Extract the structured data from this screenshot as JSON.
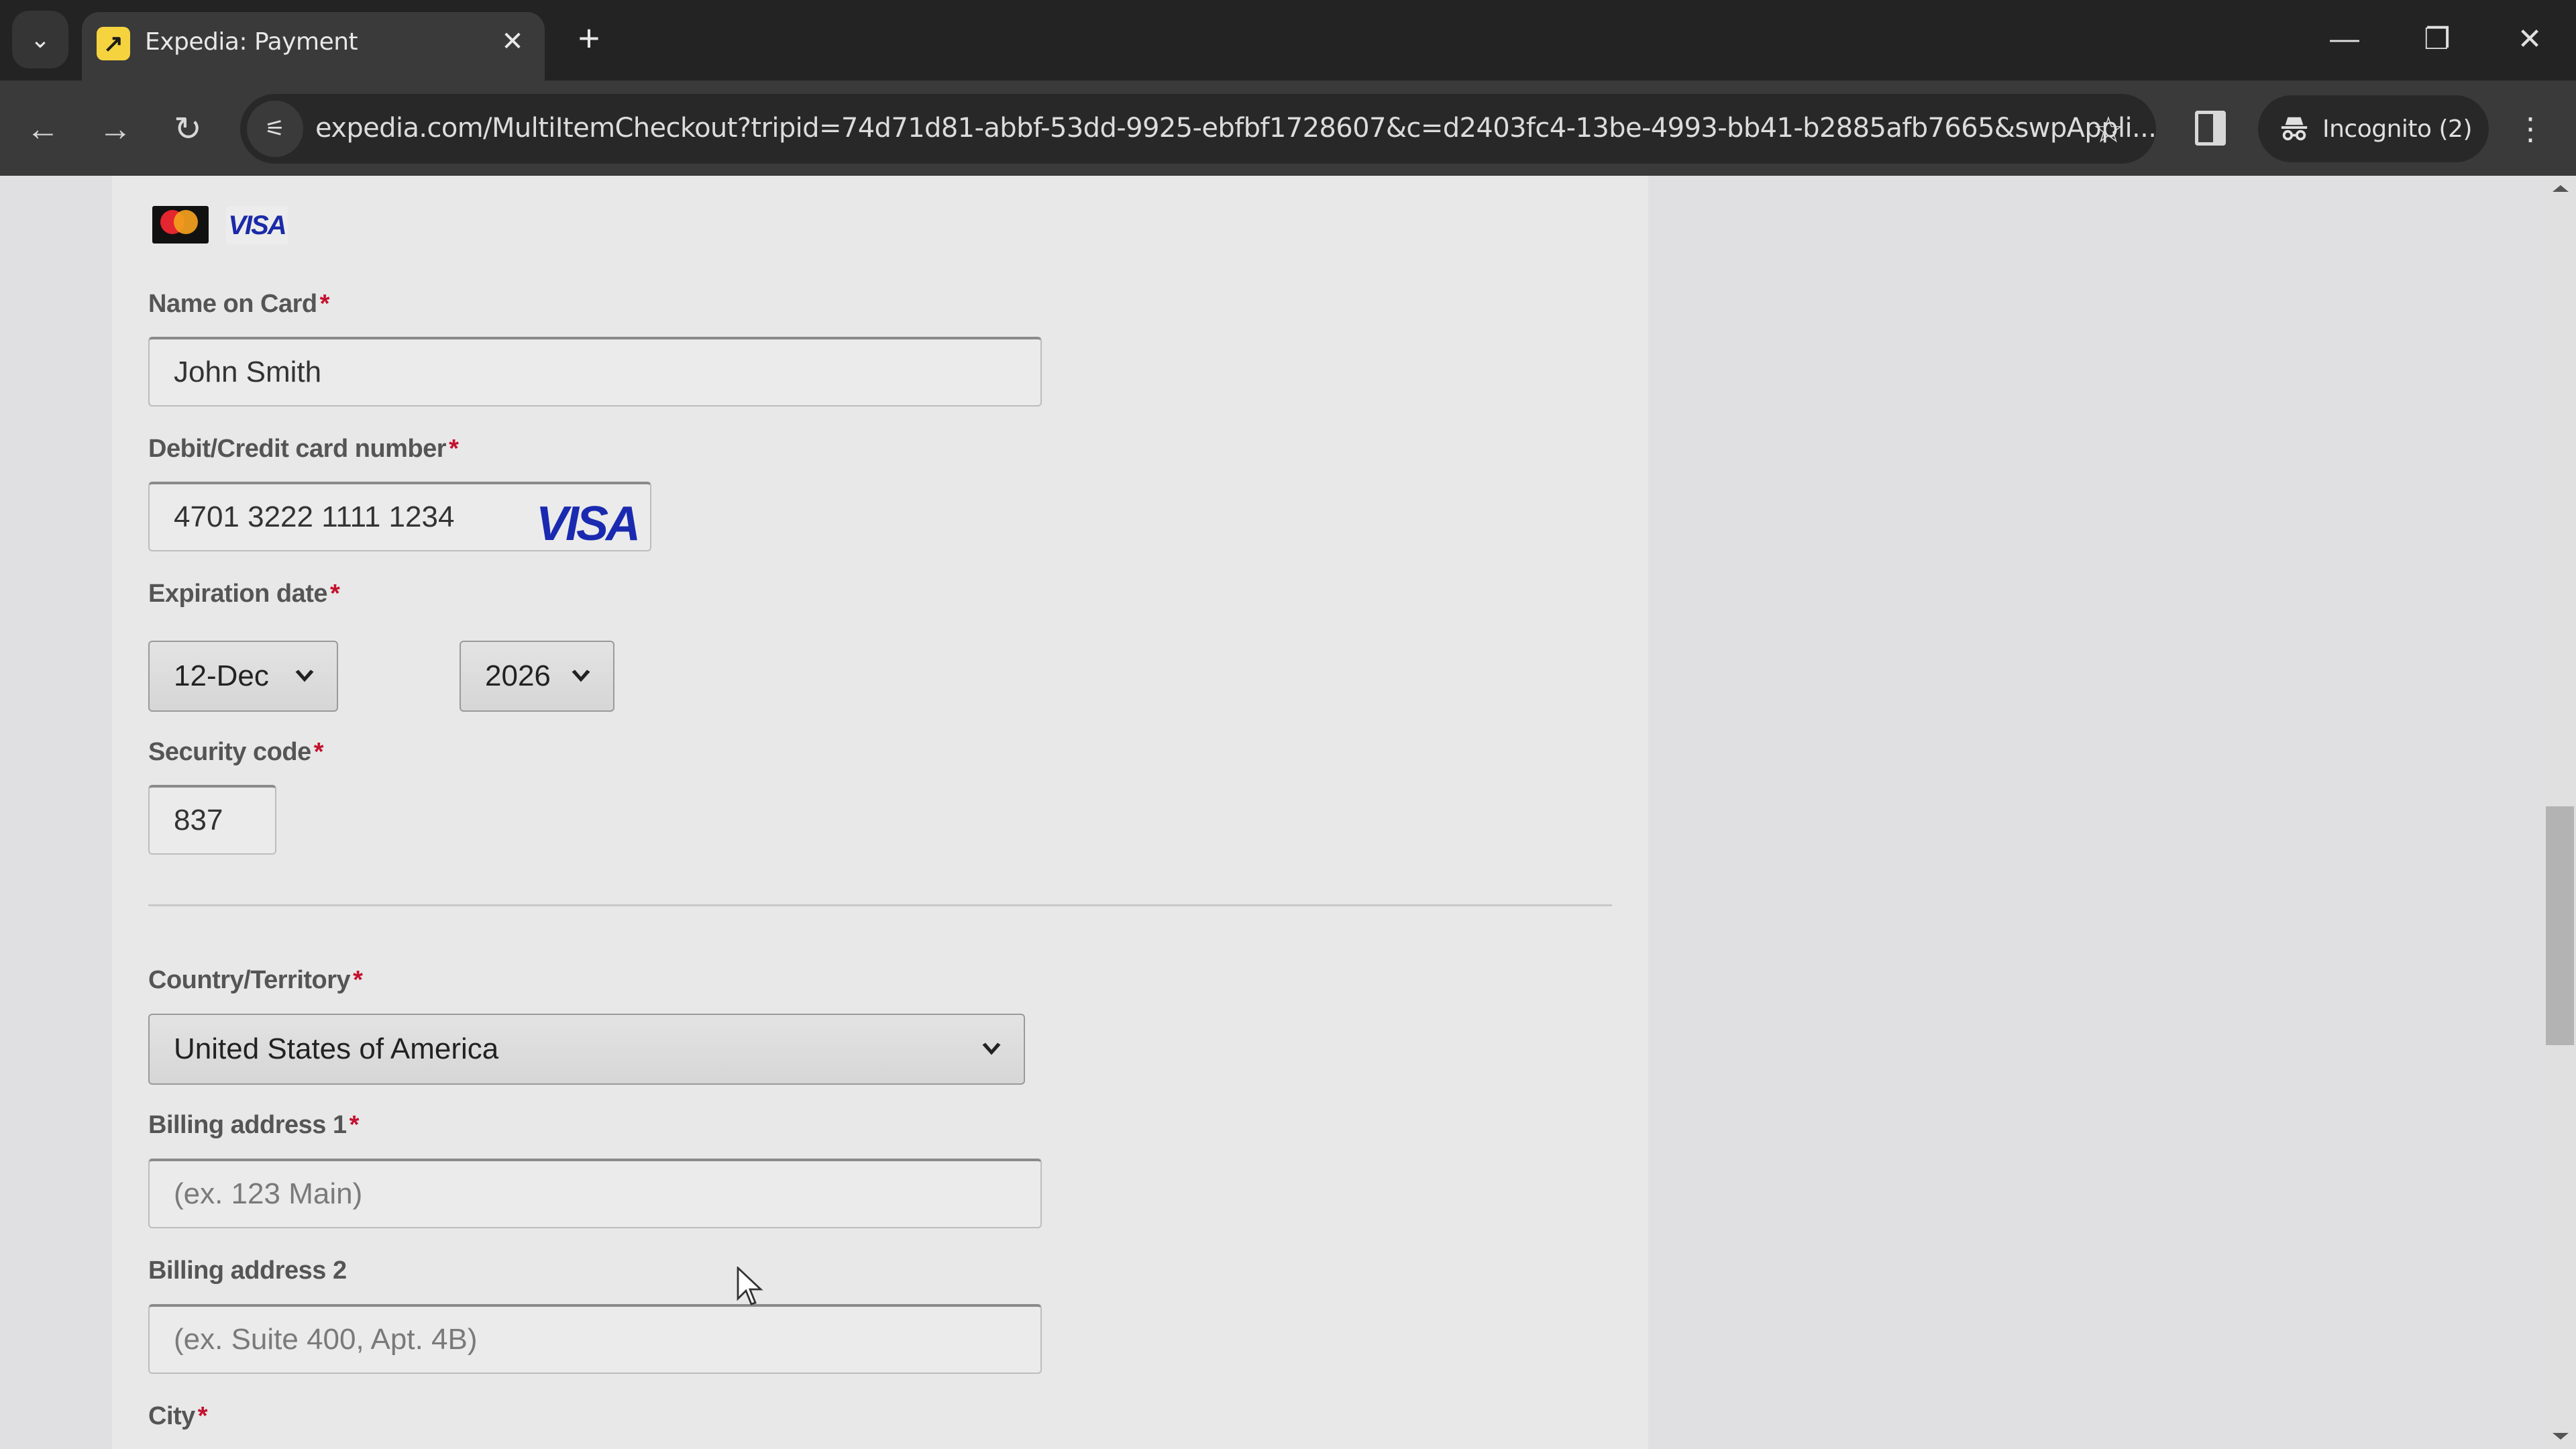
{
  "browser": {
    "tab_title": "Expedia: Payment",
    "url": "expedia.com/MultiItemCheckout?tripid=74d71d81-abbf-53dd-9925-ebfbf1728607&c=d2403fc4-13be-4993-bb41-b2885afb7665&swpAppli...",
    "incognito_label": "Incognito (2)",
    "icons": {
      "tab_search": "chevron-down-icon",
      "favicon": "expedia-logo-icon",
      "tab_close": "close-icon",
      "new_tab": "plus-icon",
      "back": "arrow-left-icon",
      "forward": "arrow-right-icon",
      "reload": "reload-icon",
      "site_info": "tune-icon",
      "bookmark": "star-icon",
      "side_panel": "side-panel-icon",
      "incognito": "incognito-icon",
      "menu": "kebab-menu-icon",
      "minimize": "minimize-icon",
      "restore": "restore-icon",
      "close_window": "close-icon"
    },
    "glyphs": {
      "tab_search": "⌄",
      "favicon": "↗",
      "tab_close": "✕",
      "new_tab": "+",
      "back": "←",
      "forward": "→",
      "reload": "↻",
      "site_info": "⚟",
      "bookmark": "☆",
      "incognito": "🕵",
      "menu": "⋮",
      "minimize": "—",
      "restore": "❐",
      "close_window": "✕"
    }
  },
  "payment_form": {
    "accepted_cards": [
      "Mastercard",
      "VISA"
    ],
    "name_on_card": {
      "label": "Name on Card",
      "required_mark": "*",
      "value": "John Smith"
    },
    "card_number": {
      "label": "Debit/Credit card number",
      "required_mark": "*",
      "value": "4701 3222 1111 1234",
      "detected_brand": "VISA"
    },
    "expiration": {
      "label": "Expiration date",
      "required_mark": "*",
      "month": "12-Dec",
      "year": "2026"
    },
    "security_code": {
      "label": "Security code",
      "required_mark": "*",
      "value": "837"
    },
    "country": {
      "label": "Country/Territory",
      "required_mark": "*",
      "value": "United States of America"
    },
    "billing_address_1": {
      "label": "Billing address 1",
      "required_mark": "*",
      "placeholder": "(ex. 123 Main)"
    },
    "billing_address_2": {
      "label": "Billing address 2",
      "placeholder": "(ex. Suite 400, Apt. 4B)"
    },
    "city": {
      "label": "City",
      "required_mark": "*"
    }
  },
  "colors": {
    "required": "#c4112f",
    "visa_blue": "#1a2ab0",
    "expedia_yellow": "#f5d33f"
  }
}
